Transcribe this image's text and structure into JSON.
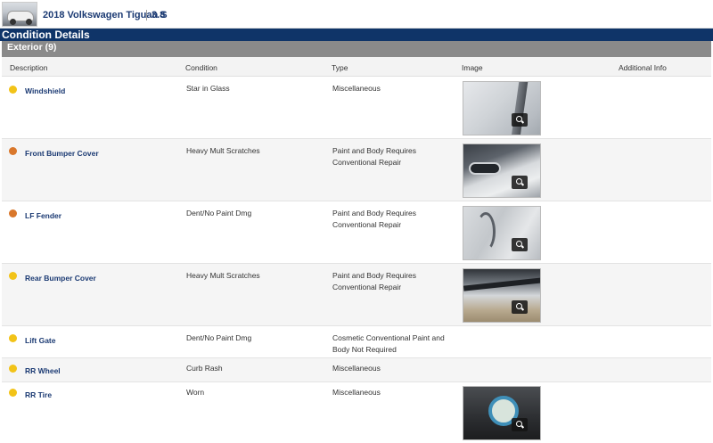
{
  "header": {
    "vehicle_title": "2018 Volkswagen Tiguan S",
    "grade": "3.8"
  },
  "section_title": "Condition Details",
  "group": {
    "label": "Exterior (9)"
  },
  "columns": [
    "Description",
    "Condition",
    "Type",
    "Image",
    "Additional Info"
  ],
  "colors": {
    "navy": "#0f3468",
    "yellow": "#f2c318",
    "orange": "#d9772b"
  },
  "rows": [
    {
      "description": "Windshield",
      "condition": "Star in Glass",
      "type": "Miscellaneous",
      "severity": "yellow",
      "has_image": true
    },
    {
      "description": "Front Bumper Cover",
      "condition": "Heavy Mult Scratches",
      "type": "Paint and Body Requires Conventional Repair",
      "severity": "orange",
      "has_image": true
    },
    {
      "description": "LF Fender",
      "condition": "Dent/No Paint Dmg",
      "type": "Paint and Body Requires Conventional Repair",
      "severity": "orange",
      "has_image": true
    },
    {
      "description": "Rear Bumper Cover",
      "condition": "Heavy Mult Scratches",
      "type": "Paint and Body Requires Conventional Repair",
      "severity": "yellow",
      "has_image": true
    },
    {
      "description": "Lift Gate",
      "condition": "Dent/No Paint Dmg",
      "type": "Cosmetic Conventional Paint and Body Not Required",
      "severity": "yellow",
      "has_image": false
    },
    {
      "description": "RR Wheel",
      "condition": "Curb Rash",
      "type": "Miscellaneous",
      "severity": "yellow",
      "has_image": false
    },
    {
      "description": "RR Tire",
      "condition": "Worn",
      "type": "Miscellaneous",
      "severity": "yellow",
      "has_image": true
    }
  ]
}
